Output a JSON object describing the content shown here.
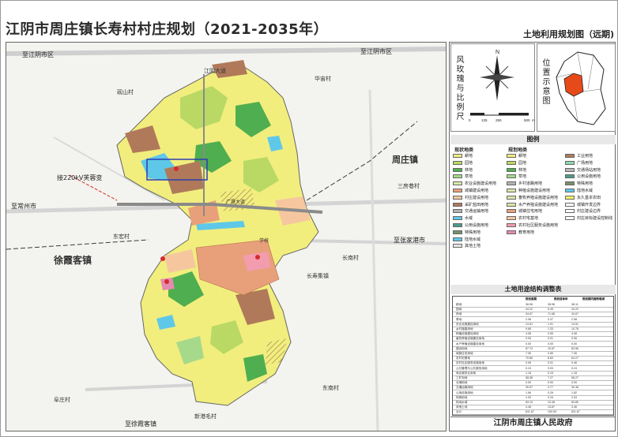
{
  "title": "江阴市周庄镇长寿村村庄规划（2021-2035年）",
  "panel": {
    "map_title": "土地利用规划图（远期)",
    "compass_label": "风玫瑰与比例尺",
    "location_label": "位置示意图",
    "scale_ticks": [
      "0",
      "125",
      "250",
      "500"
    ],
    "scale_unit": "m",
    "north_label": "N"
  },
  "legend": {
    "title": "图例",
    "status_header": "现状地类",
    "plan_header": "规划地类",
    "status_items": [
      "耕地",
      "园地",
      "林地",
      "草地",
      "农业设施建设用地",
      "城镇建设用地",
      "村庄建设用地",
      "采矿盐田用地",
      "交通运输用地",
      "水域",
      "公用设施用地",
      "特殊用地",
      "陆地水域",
      "其他土地"
    ],
    "plan_items": [
      "耕地",
      "园地",
      "林地",
      "草地",
      "乡村道路用地",
      "种植设施建设用地",
      "畜牧养殖设施建设用地",
      "水产养殖设施建设用地",
      "城镇住宅用地",
      "农村宅基地",
      "农村社区服务设施用地",
      "教育用地"
    ],
    "plan_items_right": [
      "工业用地",
      "广场用地",
      "交通场站用地",
      "公用设施用地",
      "特殊用地",
      "陆地水域",
      "永久基本农田",
      "城镇开发边界",
      "村庄建设边界",
      "村庄目标建设控制线"
    ],
    "colors": {
      "farmland": "#f1ee7e",
      "garden": "#b9d964",
      "forest": "#4fae4f",
      "grass": "#a7d98a",
      "road": "#b2b2b2",
      "facility": "#d8e9a8",
      "urban_res": "#e8a07a",
      "rural_res": "#f6c79f",
      "service": "#f29cae",
      "education": "#e58ab0",
      "industry": "#b07a5a",
      "square": "#8fd8b0",
      "transport": "#b8b8b8",
      "utility": "#4c9c8c",
      "special": "#7a8f6a",
      "water": "#5fc8e8",
      "basic_farm": "#f6f36a",
      "boundary_red": "#d62b2b",
      "boundary_blue": "#2f3fb0"
    }
  },
  "table": {
    "title": "土地用途结构调整表",
    "headers": [
      "规划基期",
      "规划目标年",
      "规划期内面积增减"
    ],
    "rows": [
      [
        "耕地",
        "38.96",
        "38.96",
        "38.11"
      ],
      [
        "园地",
        "44.22",
        "5.45",
        "44.22"
      ],
      [
        "林地",
        "34.67",
        "71.68",
        "34.67"
      ],
      [
        "草地",
        "2.98",
        "0.37",
        "2.98"
      ],
      [
        "农业设施建设用地",
        "13.51",
        "1.91",
        "13.51"
      ],
      [
        "乡村道路用地",
        "9.66",
        "1.33",
        "10.78"
      ],
      [
        "种植设施建设用地",
        "4.08",
        "0.55",
        "4.08"
      ],
      [
        "畜牧养殖设施建设用地",
        "0.06",
        "0.01",
        "0.06"
      ],
      [
        "水产养殖设施建设用地",
        "0.00",
        "0.00",
        "0.00"
      ],
      [
        "建设用地",
        "87.74",
        "10.67",
        "83.96"
      ],
      [
        "城镇住宅用地",
        "7.06",
        "0.85",
        "7.06"
      ],
      [
        "农村宅基地",
        "70.66",
        "8.83",
        "64.27"
      ],
      [
        "农村社区服务设施用地",
        "0.06",
        "0.01",
        "0.46"
      ],
      [
        "公共管理与公共服务用地",
        "0.24",
        "0.03",
        "0.24"
      ],
      [
        "商业服务业用地",
        "1.18",
        "0.15",
        "1.18"
      ],
      [
        "工矿用地",
        "58.58",
        "7.27",
        "58.27"
      ],
      [
        "仓储用地",
        "0.00",
        "0.00",
        "0.00"
      ],
      [
        "交通运输用地",
        "30.57",
        "3.77",
        "30.46"
      ],
      [
        "公用设施用地",
        "1.96",
        "0.26",
        "1.82"
      ],
      [
        "特殊用地",
        "1.93",
        "0.24",
        "2.03"
      ],
      [
        "陆地水域",
        "83.10",
        "10.38",
        "83.80"
      ],
      [
        "其他土地",
        "4.48",
        "13.87",
        "3.46"
      ],
      [
        "合计",
        "811.67",
        "100.00",
        "811.67"
      ]
    ]
  },
  "footer": "江阴市周庄镇人民政府",
  "map_labels": {
    "north_city_left": "至江阴市区",
    "north_city_right": "至江阴市区",
    "road_jiangyin": "江阴大道",
    "village_yashan": "砚山村",
    "village_huanan": "华宙村",
    "village_sanfang": "三房巷村",
    "village_dongjia": "东宏村",
    "village_changnan": "长南村",
    "village_changshou": "长寿集镇",
    "village_dongnan": "东南村",
    "village_xinjiangzhai": "新港毛村",
    "village_fuzhuang": "阜庄村",
    "substation": "接220kV芙蓉变",
    "to_changzhou": "至常州市",
    "to_zhangjiagang": "至张家港市",
    "town_zhouzhuang": "周庄镇",
    "town_xuxiake": "徐霞客镇",
    "to_xuxiake": "至徐霞客镇",
    "road_guangchang": "广晟大道",
    "school_label": "学校"
  }
}
